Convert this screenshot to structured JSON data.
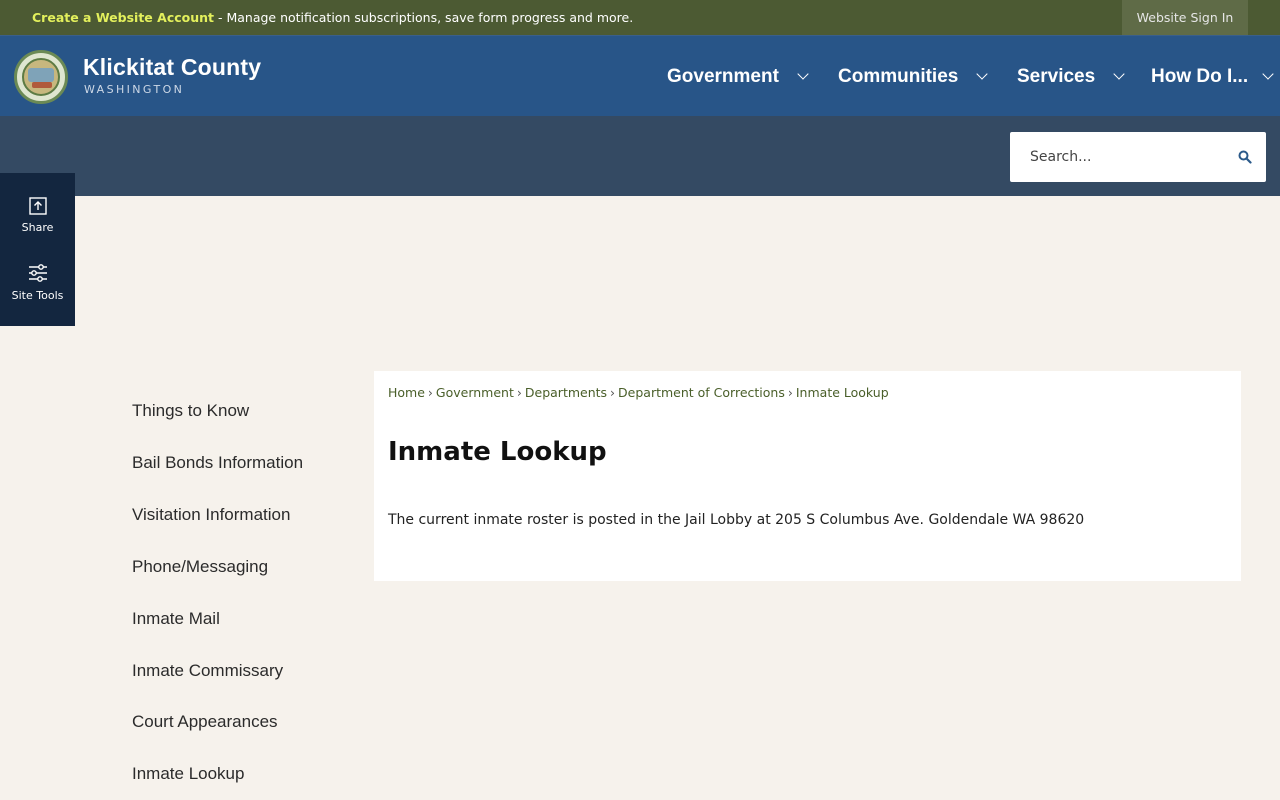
{
  "topbar": {
    "create_link": "Create a Website Account",
    "message": " - Manage notification subscriptions, save form progress and more.",
    "signin_label": "Website Sign In"
  },
  "header": {
    "site_name": "Klickitat County",
    "site_sub": "WASHINGTON",
    "nav": [
      {
        "label": "Government"
      },
      {
        "label": "Communities"
      },
      {
        "label": "Services"
      },
      {
        "label": "How Do I..."
      }
    ]
  },
  "search": {
    "placeholder": "Search..."
  },
  "tools": {
    "share_label": "Share",
    "site_tools_label": "Site Tools"
  },
  "sidenav": {
    "items": [
      {
        "label": "Things to Know"
      },
      {
        "label": "Bail Bonds Information"
      },
      {
        "label": "Visitation Information"
      },
      {
        "label": "Phone/Messaging"
      },
      {
        "label": "Inmate Mail"
      },
      {
        "label": "Inmate Commissary"
      },
      {
        "label": "Court Appearances"
      },
      {
        "label": "Inmate Lookup"
      }
    ]
  },
  "breadcrumb": {
    "items": [
      "Home",
      "Government",
      "Departments",
      "Department of Corrections",
      "Inmate Lookup"
    ]
  },
  "content": {
    "title": "Inmate Lookup",
    "text": "The current inmate roster is posted in the Jail Lobby at 205 S Columbus Ave. Goldendale WA 98620"
  },
  "colors": {
    "topbar": "#4c5a33",
    "header": "#285588",
    "searchband": "#344a63",
    "tools": "#13263f",
    "accent_link": "#e3f05c",
    "breadcrumb_link": "#4a5f2a"
  }
}
